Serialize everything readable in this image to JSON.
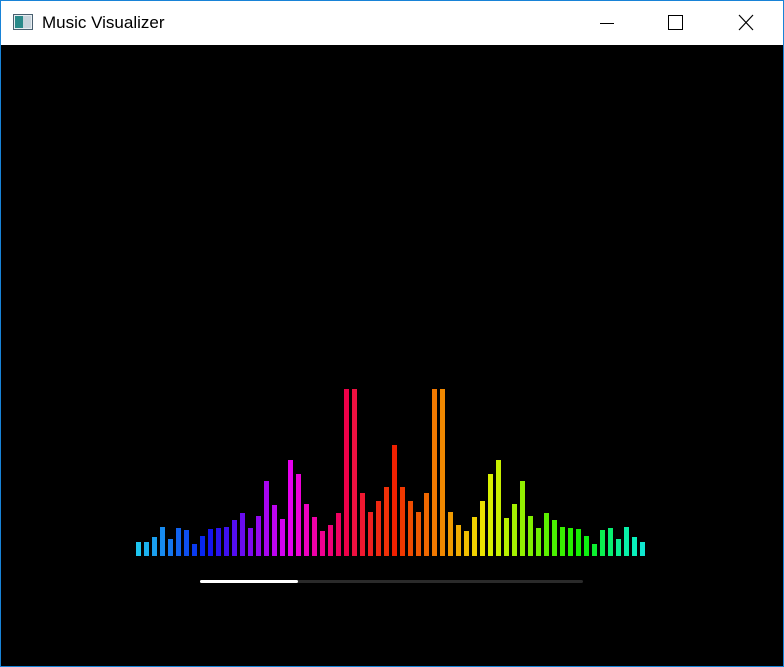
{
  "window": {
    "title": "Music Visualizer",
    "app_icon": "window-app-icon",
    "controls": [
      {
        "name": "minimize-button",
        "icon": "minimize-icon"
      },
      {
        "name": "maximize-button",
        "icon": "maximize-icon"
      },
      {
        "name": "close-button",
        "icon": "close-icon"
      }
    ]
  },
  "visualizer": {
    "max_level": 167,
    "levels": [
      14,
      14,
      19,
      29,
      17,
      28,
      26,
      12,
      20,
      27,
      28,
      29,
      36,
      43,
      28,
      40,
      75,
      51,
      37,
      96,
      82,
      52,
      39,
      25,
      31,
      43,
      167,
      167,
      63,
      44,
      55,
      69,
      111,
      69,
      55,
      44,
      63,
      167,
      167,
      44,
      31,
      25,
      39,
      55,
      82,
      96,
      38,
      52,
      75,
      40,
      28,
      43,
      36,
      29,
      28,
      27,
      20,
      12,
      26,
      28,
      17,
      29,
      19,
      14
    ],
    "colors": [
      "#1dc5f0",
      "#1cb1ee",
      "#1a9fee",
      "#178bf0",
      "#1477f0",
      "#1163f0",
      "#0e4ff0",
      "#0b3bf0",
      "#0827f0",
      "#1515f0",
      "#2a12f0",
      "#3f10f0",
      "#540ef0",
      "#690cf0",
      "#7e0af0",
      "#9308f0",
      "#a806f0",
      "#bd04f0",
      "#d202f0",
      "#e600ee",
      "#ee00d8",
      "#ee00c0",
      "#ee00a8",
      "#ee0090",
      "#ee0078",
      "#ee0060",
      "#ee0048",
      "#ee1040",
      "#f01830",
      "#f02020",
      "#f02810",
      "#f03008",
      "#f02000",
      "#f03800",
      "#f04c00",
      "#f05800",
      "#f06800",
      "#f07800",
      "#f08800",
      "#f09a00",
      "#f0ac00",
      "#f0be00",
      "#f0d000",
      "#eae200",
      "#d8f000",
      "#c8f000",
      "#b8f000",
      "#a4f000",
      "#92f000",
      "#80f000",
      "#6ef000",
      "#5cf000",
      "#4af000",
      "#38f000",
      "#26f000",
      "#16f000",
      "#0ef010",
      "#0cf030",
      "#0af050",
      "#08f070",
      "#08f090",
      "#08f0a8",
      "#08f0bc",
      "#10e8d0"
    ]
  },
  "progress": {
    "fraction": 0.255,
    "fill_color": "#ffffff",
    "track_color": "#2a2a2a"
  }
}
